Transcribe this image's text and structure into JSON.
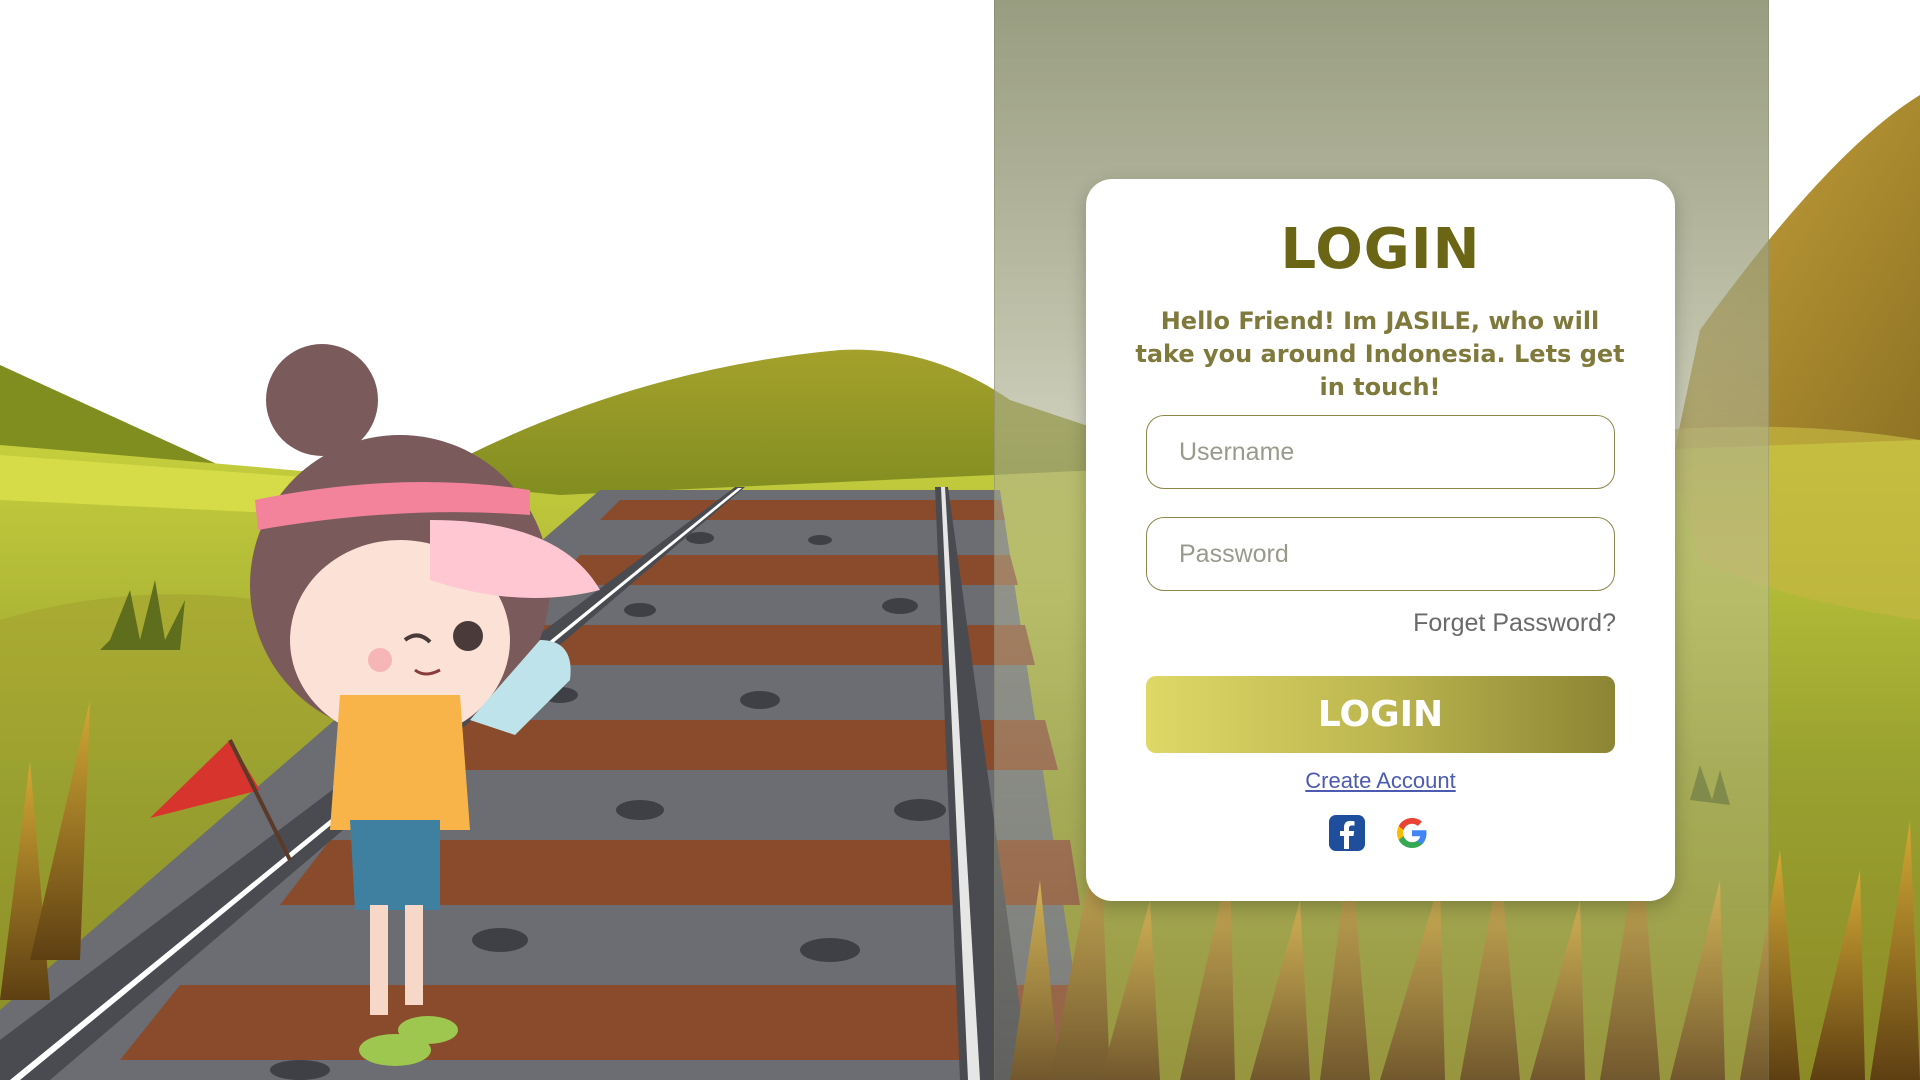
{
  "login": {
    "title": "LOGIN",
    "greeting": "Hello Friend! Im JASILE, who will take you around Indonesia. Lets get in touch!",
    "username_placeholder": "Username",
    "password_placeholder": "Password",
    "forgot_password": "Forget Password?",
    "login_button": "LOGIN",
    "create_account": "Create Account",
    "social_icons": [
      "facebook-icon",
      "google-icon"
    ]
  },
  "colors": {
    "title": "#6b6516",
    "button_start": "#ded867",
    "button_end": "#8c8534",
    "link": "#4b5bb0"
  }
}
